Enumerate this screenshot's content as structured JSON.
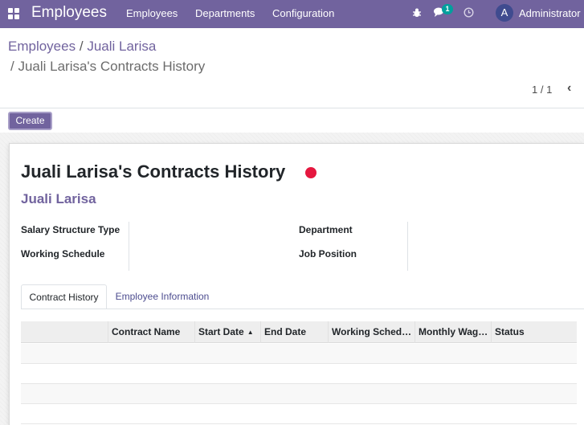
{
  "navbar": {
    "app_title": "Employees",
    "menu": [
      "Employees",
      "Departments",
      "Configuration"
    ],
    "messages_count": "1",
    "avatar_letter": "A",
    "user_name": "Administrator (c"
  },
  "breadcrumb": {
    "root": "Employees",
    "sep": "/",
    "employee": "Juali Larisa",
    "current": "/ Juali Larisa's Contracts History"
  },
  "pager": {
    "value": "1 / 1",
    "prev": "‹"
  },
  "create_label": "Create",
  "form": {
    "title": "Juali Larisa's Contracts History",
    "status_color": "#e5173f",
    "employee_name": "Juali Larisa",
    "fields": {
      "salary_structure_type": "Salary Structure Type",
      "working_schedule": "Working Schedule",
      "department": "Department",
      "job_position": "Job Position"
    }
  },
  "tabs": [
    "Contract History",
    "Employee Information"
  ],
  "table": {
    "columns": [
      "Contract Name",
      "Start Date",
      "End Date",
      "Working Sched…",
      "Monthly Wag…",
      "Status"
    ],
    "sort_indicator": "▲",
    "rows": []
  },
  "colors": {
    "brand": "#71639e",
    "accent": "#00a09d"
  }
}
